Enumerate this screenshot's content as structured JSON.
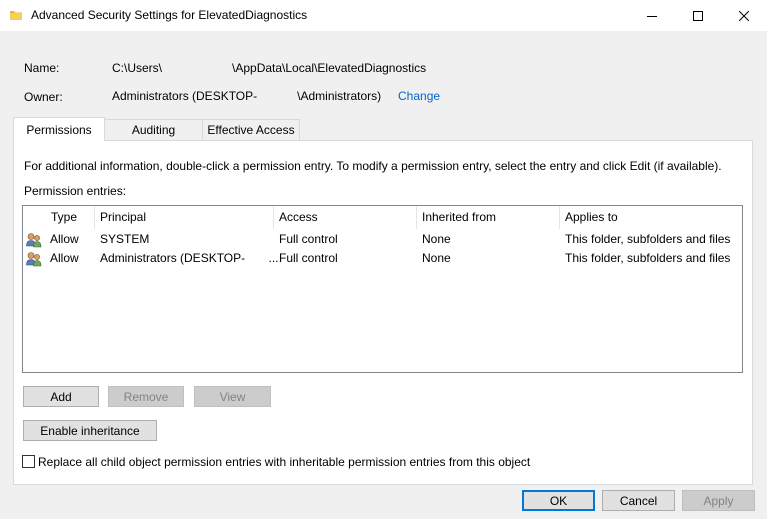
{
  "window": {
    "title": "Advanced Security Settings for ElevatedDiagnostics",
    "title_icon": "folder-icon",
    "controls": [
      "minimize-icon",
      "maximize-icon",
      "close-icon"
    ]
  },
  "info": {
    "name_label": "Name:",
    "name_value": "C:\\Users\\                     \\AppData\\Local\\ElevatedDiagnostics",
    "owner_label": "Owner:",
    "owner_value": "Administrators (DESKTOP-            \\Administrators)",
    "owner_change": "Change"
  },
  "tabs": [
    {
      "label": "Permissions",
      "selected": true
    },
    {
      "label": "Auditing",
      "selected": false
    },
    {
      "label": "Effective Access",
      "selected": false
    }
  ],
  "permissions": {
    "info_text": "For additional information, double-click a permission entry. To modify a permission entry, select the entry and click Edit (if available).",
    "entries_label": "Permission entries:",
    "columns": [
      "Type",
      "Principal",
      "Access",
      "Inherited from",
      "Applies to"
    ],
    "rows": [
      {
        "icon": "users-icon",
        "type": "Allow",
        "principal": "SYSTEM",
        "access": "Full control",
        "inherited_from": "None",
        "applies_to": "This folder, subfolders and files"
      },
      {
        "icon": "users-icon",
        "type": "Allow",
        "principal": "Administrators (DESKTOP-       ...",
        "access": "Full control",
        "inherited_from": "None",
        "applies_to": "This folder, subfolders and files"
      }
    ],
    "add_button": "Add",
    "remove_button": "Remove",
    "view_button": "View",
    "enable_inheritance_button": "Enable inheritance",
    "replace_checkbox_label": "Replace all child object permission entries with inheritable permission entries from this object",
    "replace_checked": false
  },
  "footer": {
    "ok": "OK",
    "cancel": "Cancel",
    "apply": "Apply"
  },
  "colors": {
    "link": "#0066cc",
    "default_button_border": "#0078d7",
    "disabled_text": "#838383"
  }
}
